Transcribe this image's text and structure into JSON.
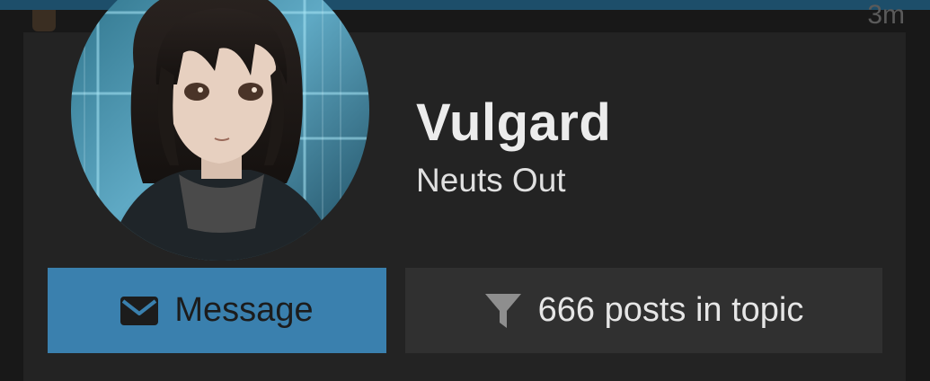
{
  "background": {
    "time_label": "3m"
  },
  "profile": {
    "username": "Vulgard",
    "user_title": "Neuts Out"
  },
  "actions": {
    "message_label": "Message",
    "message_icon": "envelope-icon",
    "posts_label": "666 posts in topic",
    "posts_icon": "filter-icon"
  },
  "colors": {
    "accent": "#3a80ae",
    "card_bg": "#232323",
    "secondary_button": "#303030",
    "top_stripe": "#1d4e6a"
  }
}
